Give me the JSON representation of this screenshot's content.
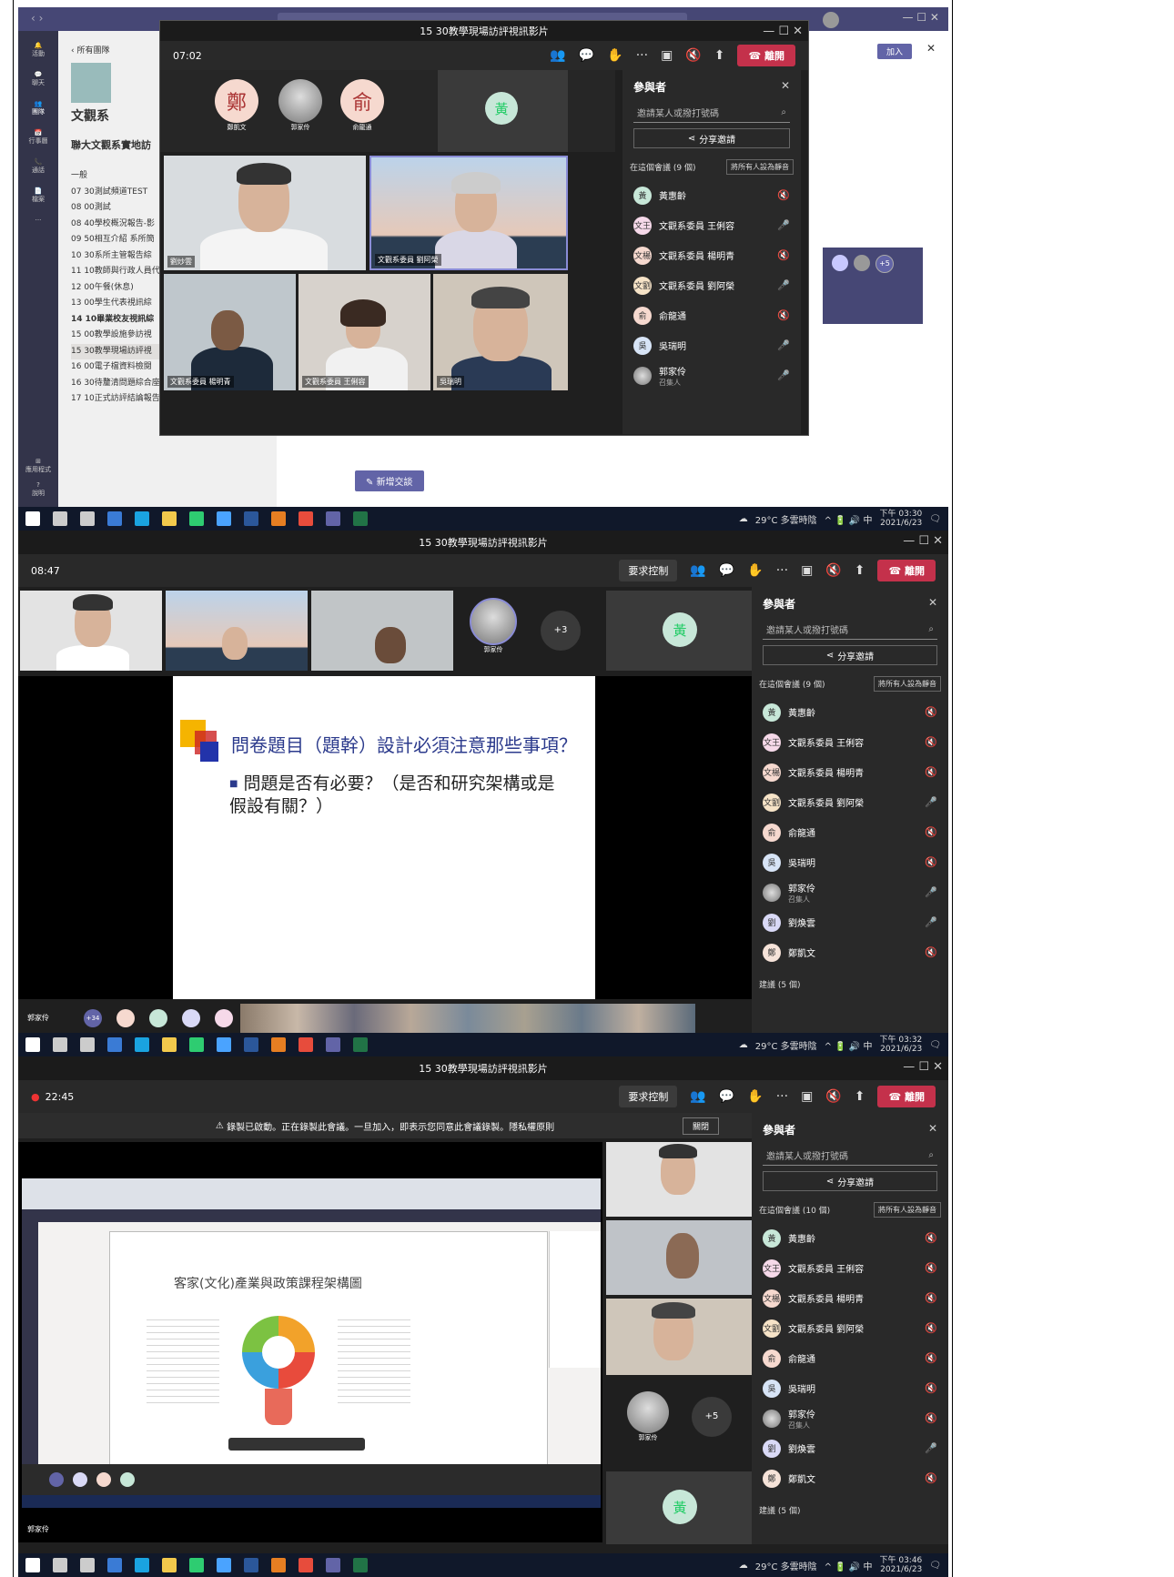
{
  "shot1": {
    "meeting_title": "15 30教學現場訪評視訊影片",
    "timer": "07:02",
    "leave_label": "離開",
    "team_back": "所有團隊",
    "team_name": "文觀系",
    "team_full": "聯大文觀系實地訪",
    "channels": [
      "一般",
      "07 30測試頻道TEST",
      "08 00測試",
      "08 40學校概況報告-影",
      "09 50相互介紹 系所簡",
      "10 30系所主管報告綜",
      "11 10教師與行政人員代",
      "12 00午餐(休息)",
      "13 00學生代表視訊綜",
      "14 10畢業校友視訊綜",
      "15 00教學設施參訪視",
      "15 30教學現場訪評視",
      "16 00電子檔資料檢閱",
      "16 30待釐清問題綜合座",
      "17 10正式訪評結論報告"
    ],
    "rail": [
      "活動",
      "聊天",
      "團隊",
      "行事曆",
      "通話",
      "檔案",
      "應用程式",
      "說明"
    ],
    "join_label": "加入",
    "new_convo": "新增交談",
    "top_avatars": [
      {
        "initial": "鄭",
        "name": "鄭凱文"
      },
      {
        "initial": "",
        "name": "郭家伶"
      },
      {
        "initial": "俞",
        "name": "俞龍通"
      }
    ],
    "right_avatar": "黃",
    "video_names": [
      "劉炒雲",
      "文觀系委員 劉阿榮",
      "文觀系委員 楊明青",
      "文觀系委員 王俐容",
      "吳瑞明"
    ],
    "panel": {
      "title": "參與者",
      "search": "邀請某人或撥打號碼",
      "share": "分享邀請",
      "section": "在這個會議 (9 個)",
      "mute_all": "將所有人設為靜音",
      "people": [
        {
          "name": "黃惠齡",
          "sub": "",
          "initial": "黃",
          "mic": "muted"
        },
        {
          "name": "文觀系委員 王俐容",
          "sub": "",
          "initial": "文王",
          "mic": "on"
        },
        {
          "name": "文觀系委員 楊明青",
          "sub": "",
          "initial": "文楊",
          "mic": "muted"
        },
        {
          "name": "文觀系委員 劉阿榮",
          "sub": "",
          "initial": "文劉",
          "mic": "on"
        },
        {
          "name": "俞龍通",
          "sub": "",
          "initial": "俞",
          "mic": "muted"
        },
        {
          "name": "吳瑞明",
          "sub": "",
          "initial": "吳",
          "mic": "on"
        },
        {
          "name": "郭家伶",
          "sub": "召集人",
          "initial": "",
          "mic": "on"
        }
      ]
    },
    "plus_badge": "+5",
    "weather": "29°C 多雲時陰",
    "time": "下午 03:30",
    "date": "2021/6/23"
  },
  "shot2": {
    "meeting_title": "15 30教學現場訪評視訊影片",
    "timer": "08:47",
    "request_control": "要求控制",
    "leave_label": "離開",
    "self_name": "郭家伶",
    "plus_count": "+3",
    "right_avatar": "黃",
    "slide_title": "問卷題目（題幹）設計必須注意那些事項？",
    "slide_bullet": "問題是否有必要？（是否和研究架構或是假設有關？）",
    "bottom_name": "郭家伶",
    "bottom_badge": "+34",
    "panel": {
      "title": "參與者",
      "search": "邀請某人或撥打號碼",
      "share": "分享邀請",
      "section": "在這個會議 (9 個)",
      "mute_all": "將所有人設為靜音",
      "people": [
        {
          "name": "黃惠齡",
          "sub": "",
          "initial": "黃",
          "mic": "muted"
        },
        {
          "name": "文觀系委員 王俐容",
          "sub": "",
          "initial": "文王",
          "mic": "muted"
        },
        {
          "name": "文觀系委員 楊明青",
          "sub": "",
          "initial": "文楊",
          "mic": "muted"
        },
        {
          "name": "文觀系委員 劉阿榮",
          "sub": "",
          "initial": "文劉",
          "mic": "on"
        },
        {
          "name": "俞龍通",
          "sub": "",
          "initial": "俞",
          "mic": "muted"
        },
        {
          "name": "吳瑞明",
          "sub": "",
          "initial": "吳",
          "mic": "muted"
        },
        {
          "name": "郭家伶",
          "sub": "召集人",
          "initial": "",
          "mic": "on"
        },
        {
          "name": "劉煥雲",
          "sub": "",
          "initial": "劉",
          "mic": "on"
        },
        {
          "name": "鄭凱文",
          "sub": "",
          "initial": "鄭",
          "mic": "muted"
        }
      ],
      "section2": "建議 (5 個)"
    },
    "weather": "29°C 多雲時陰",
    "time": "下午 03:32",
    "date": "2021/6/23"
  },
  "shot3": {
    "meeting_title": "15 30教學現場訪評視訊影片",
    "timer": "22:45",
    "request_control": "要求控制",
    "leave_label": "離開",
    "banner": "錄製已啟動。正在錄製此會議。一旦加入，即表示您同意此會議錄製。隱私權原則",
    "banner_close": "關閉",
    "share_chart_title": "客家(文化)產業與政策課程架構圖",
    "self_name": "郭家伶",
    "plus_count": "+5",
    "right_avatar": "黃",
    "bottom_name": "郭家伶",
    "panel": {
      "title": "參與者",
      "search": "邀請某人或撥打號碼",
      "share": "分享邀請",
      "section": "在這個會議 (10 個)",
      "mute_all": "將所有人設為靜音",
      "people": [
        {
          "name": "黃惠齡",
          "sub": "",
          "initial": "黃",
          "mic": "muted"
        },
        {
          "name": "文觀系委員 王俐容",
          "sub": "",
          "initial": "文王",
          "mic": "muted"
        },
        {
          "name": "文觀系委員 楊明青",
          "sub": "",
          "initial": "文楊",
          "mic": "muted"
        },
        {
          "name": "文觀系委員 劉阿榮",
          "sub": "",
          "initial": "文劉",
          "mic": "muted"
        },
        {
          "name": "俞龍通",
          "sub": "",
          "initial": "俞",
          "mic": "muted"
        },
        {
          "name": "吳瑞明",
          "sub": "",
          "initial": "吳",
          "mic": "muted"
        },
        {
          "name": "郭家伶",
          "sub": "召集人",
          "initial": "",
          "mic": "muted"
        },
        {
          "name": "劉煥雲",
          "sub": "",
          "initial": "劉",
          "mic": "on"
        },
        {
          "name": "鄭凱文",
          "sub": "",
          "initial": "鄭",
          "mic": "muted"
        }
      ],
      "section2": "建議 (5 個)"
    },
    "weather": "29°C 多雲時陰",
    "time": "下午 03:46",
    "date": "2021/6/23"
  },
  "colors": {
    "leave": "#c4314b",
    "teams_purple": "#6264a7",
    "panel_bg": "#292929",
    "meeting_bg": "#1f1f1f",
    "taskbar": "#10182a"
  }
}
